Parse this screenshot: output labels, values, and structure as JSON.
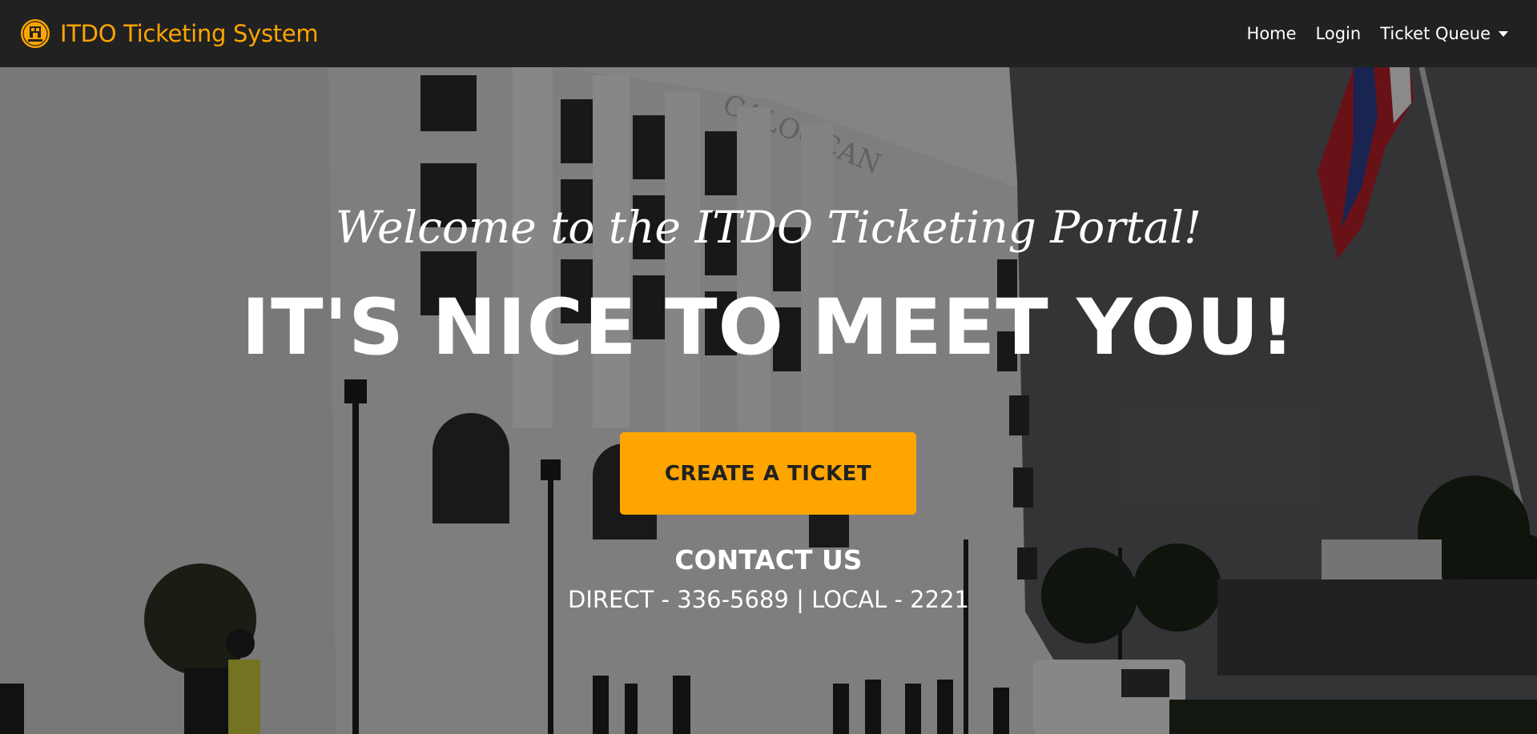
{
  "navbar": {
    "brand": "ITDO Ticketing System",
    "logo_icon": "city-seal-logo",
    "links": {
      "home": "Home",
      "login": "Login",
      "ticket_queue": "Ticket Queue"
    }
  },
  "hero": {
    "subheading": "Welcome to the ITDO Ticketing Portal!",
    "heading": "IT'S NICE TO MEET YOU!",
    "cta_label": "CREATE A TICKET",
    "contact_title": "CONTACT US",
    "contact_direct": "DIRECT - 336-5689",
    "contact_separator": "|",
    "contact_local": "LOCAL - 2221",
    "background_text": "CALOOCAN"
  },
  "colors": {
    "accent": "#fea501",
    "navbar_bg": "#212121",
    "text": "#ffffff"
  }
}
